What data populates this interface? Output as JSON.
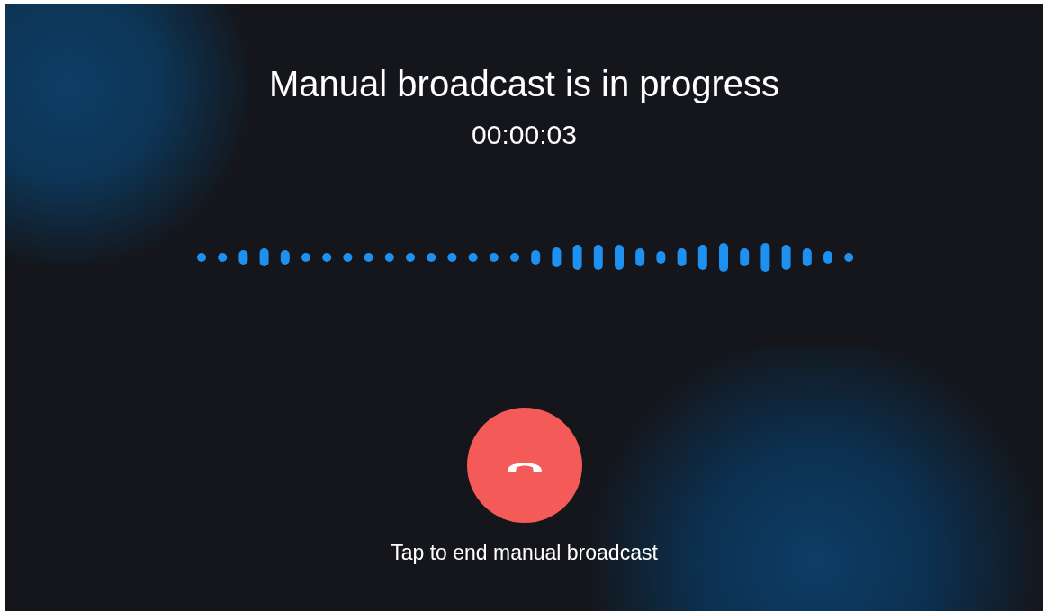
{
  "title": "Manual broadcast is in progress",
  "timer": "00:00:03",
  "end_button": {
    "hint": "Tap to end manual broadcast"
  }
}
